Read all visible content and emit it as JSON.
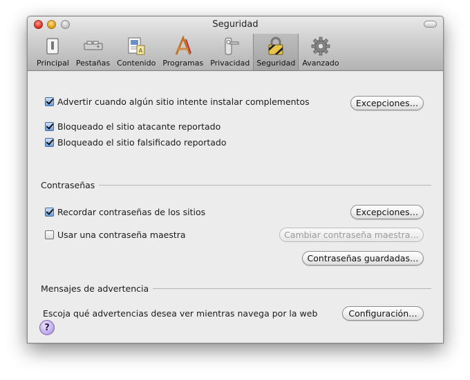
{
  "window": {
    "title": "Seguridad"
  },
  "tabs": [
    {
      "label": "Principal",
      "icon": "switch-icon"
    },
    {
      "label": "Pestañas",
      "icon": "tabs-icon"
    },
    {
      "label": "Contenido",
      "icon": "content-icon"
    },
    {
      "label": "Programas",
      "icon": "applications-icon"
    },
    {
      "label": "Privacidad",
      "icon": "privacy-icon"
    },
    {
      "label": "Seguridad",
      "icon": "lock-icon",
      "selected": true
    },
    {
      "label": "Avanzado",
      "icon": "gear-icon"
    }
  ],
  "general": {
    "warn_addons": {
      "label": "Advertir cuando algún sitio intente instalar complementos",
      "checked": true
    },
    "exceptions_label": "Excepciones…",
    "block_attack": {
      "label": "Bloqueado el sitio atacante reportado",
      "checked": true
    },
    "block_forgery": {
      "label": "Bloqueado el sitio falsificado reportado",
      "checked": true
    }
  },
  "passwords": {
    "heading": "Contraseñas",
    "remember": {
      "label": "Recordar contraseñas de los sitios",
      "checked": true
    },
    "exceptions_label": "Excepciones…",
    "master": {
      "label": "Usar una contraseña maestra",
      "checked": false
    },
    "change_master_label": "Cambiar contraseña maestra…",
    "saved_label": "Contraseñas guardadas…"
  },
  "warnings": {
    "heading": "Mensajes de advertencia",
    "description": "Escoja qué advertencias desea ver mientras navega por la web",
    "settings_label": "Configuración…"
  },
  "help": {
    "glyph": "?"
  }
}
